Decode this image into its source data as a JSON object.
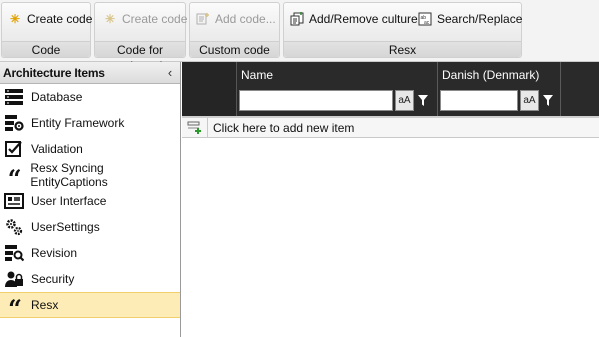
{
  "ribbon": {
    "groups": [
      {
        "caption": "Code",
        "button": "Create code"
      },
      {
        "caption": "Code for selected",
        "button": "Create code"
      },
      {
        "caption": "Custom code",
        "button": "Add code..."
      },
      {
        "caption": "Resx",
        "buttons": [
          "Add/Remove culture",
          "Search/Replace"
        ]
      }
    ]
  },
  "sidebar": {
    "title": "Architecture Items",
    "collapse_glyph": "‹",
    "items": [
      {
        "label": "Database",
        "icon": "database-icon"
      },
      {
        "label": "Entity Framework",
        "icon": "entity-framework-icon"
      },
      {
        "label": "Validation",
        "icon": "validation-icon"
      },
      {
        "label": "Resx Syncing EntityCaptions",
        "icon": "quote-icon"
      },
      {
        "label": "User Interface",
        "icon": "user-interface-icon"
      },
      {
        "label": "UserSettings",
        "icon": "gears-icon"
      },
      {
        "label": "Revision",
        "icon": "revision-icon"
      },
      {
        "label": "Security",
        "icon": "security-icon"
      },
      {
        "label": "Resx",
        "icon": "quote-icon",
        "selected": true
      }
    ]
  },
  "grid": {
    "columns": [
      {
        "title": "Name",
        "case_button": "aA"
      },
      {
        "title": "Danish (Denmark)",
        "case_button": "aA"
      }
    ],
    "add_row_text": "Click here to add new item"
  }
}
